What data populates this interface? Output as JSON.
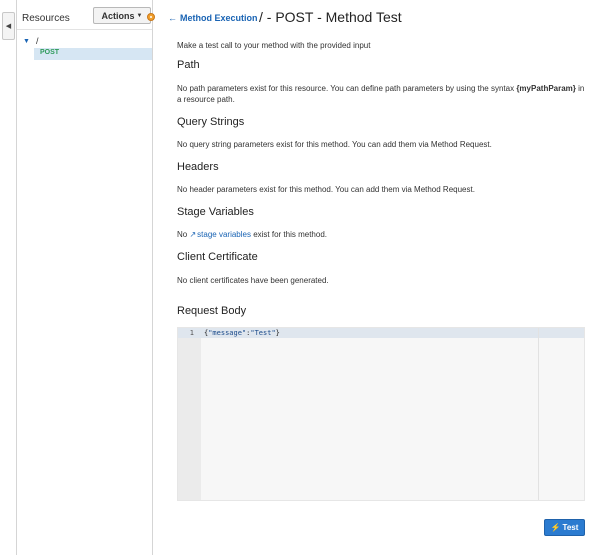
{
  "sidebar": {
    "collapse_icon": "caret-left-icon",
    "title": "Resources",
    "actions_label": "Actions",
    "tree": {
      "root_label": "/",
      "method_label": "POST"
    }
  },
  "header": {
    "back_label": "Method Execution",
    "title": "/ - POST - Method Test"
  },
  "intro": "Make a test call to your method with the provided input",
  "sections": {
    "path": {
      "heading": "Path",
      "text_before": "No path parameters exist for this resource. You can define path parameters by using the syntax ",
      "syntax": "{myPathParam}",
      "text_after": " in a resource path."
    },
    "query": {
      "heading": "Query Strings",
      "text": "No query string parameters exist for this method. You can add them via Method Request."
    },
    "headers": {
      "heading": "Headers",
      "text": "No header parameters exist for this method. You can add them via Method Request."
    },
    "stage": {
      "heading": "Stage Variables",
      "text_before": "No ",
      "link": "stage variables",
      "text_after": " exist for this method."
    },
    "cert": {
      "heading": "Client Certificate",
      "text": "No client certificates have been generated."
    },
    "body": {
      "heading": "Request Body",
      "line_number": "1",
      "code_open": "{",
      "code_key": "\"message\"",
      "code_colon": ":",
      "code_value": "\"Test\"",
      "code_close": "}"
    }
  },
  "test_button_label": "Test",
  "colors": {
    "accent": "#1a64b4",
    "method_green": "#2e9a5a",
    "status_orange": "#f19f2b",
    "button_blue": "#2b7bd0"
  }
}
